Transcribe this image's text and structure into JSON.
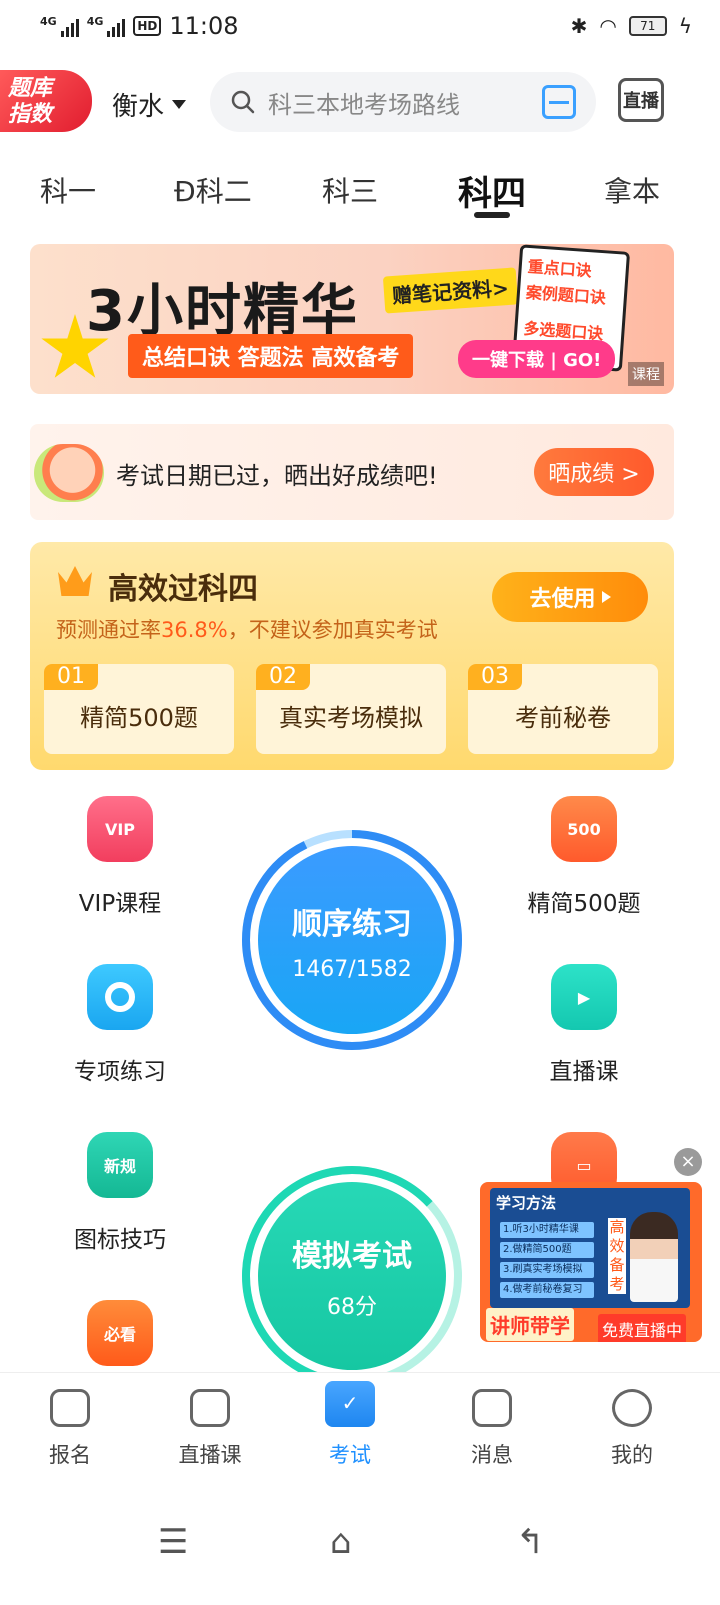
{
  "status_bar": {
    "sig1_label": "4G",
    "sig2_label": "4G",
    "hd_label": "HD",
    "time": "11:08",
    "battery": "71"
  },
  "header": {
    "badge_line1": "题库",
    "badge_line2": "指数",
    "city": "衡水",
    "search_placeholder": "科三本地考场路线",
    "live_label": "直播"
  },
  "tabs": [
    {
      "label": "科一"
    },
    {
      "label": "科二"
    },
    {
      "label": "科三"
    },
    {
      "label": "科四"
    },
    {
      "label": "拿本"
    }
  ],
  "banner": {
    "title": "3小时精华",
    "subtitle": "总结口诀 答题法 高效备考",
    "note": "赠笔记资料>",
    "card_line1": "重点口诀",
    "card_line2": "案例题口诀",
    "card_line3": "多选题口诀",
    "download": "一键下载 | GO!",
    "ad_mark": "课程"
  },
  "notice": {
    "text": "考试日期已过，晒出好成绩吧!",
    "button": "晒成绩 >"
  },
  "efficiency": {
    "title": "高效过科四",
    "subtitle_prefix": "预测通过率",
    "rate": "36.8%",
    "subtitle_suffix": "，不建议参加真实考试",
    "go_button": "去使用",
    "steps": [
      {
        "num": "01",
        "label": "精简500题"
      },
      {
        "num": "02",
        "label": "真实考场模拟"
      },
      {
        "num": "03",
        "label": "考前秘卷"
      }
    ]
  },
  "grid": {
    "vip": {
      "label": "VIP课程",
      "icon_text": "VIP"
    },
    "jj500": {
      "label": "精简500题",
      "icon_text": "500"
    },
    "special": {
      "label": "专项练习"
    },
    "live_course": {
      "label": "直播课"
    },
    "icon_tips": {
      "label": "图标技巧",
      "icon_text": "新规"
    },
    "must_see": {
      "icon_text": "必看"
    }
  },
  "sequential": {
    "title": "顺序练习",
    "progress": "1467/1582",
    "done": 1467,
    "total": 1582
  },
  "mock": {
    "title": "模拟考试",
    "score": "68分"
  },
  "promo": {
    "title": "学习方法",
    "rows": [
      "1.听3小时精华课",
      "2.做精简500题",
      "3.刷真实考场模拟",
      "4.做考前秘卷复习"
    ],
    "side": "高效备考",
    "badge1": "讲师带学",
    "badge2": "免费直播中",
    "close": "×"
  },
  "bottom_nav": [
    {
      "label": "报名"
    },
    {
      "label": "直播课"
    },
    {
      "label": "考试"
    },
    {
      "label": "消息"
    },
    {
      "label": "我的"
    }
  ],
  "colors": {
    "accent": "#1e90ff",
    "orange": "#ff5a2c",
    "gold": "#ffd96e"
  }
}
